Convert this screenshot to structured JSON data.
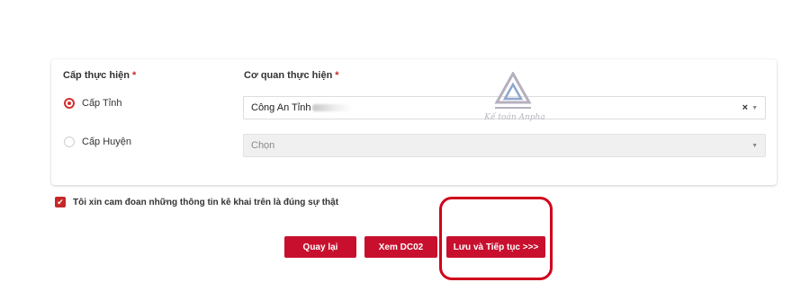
{
  "form": {
    "level_label": "Cấp thực hiện",
    "agency_label": "Cơ quan thực hiện",
    "required_mark": "*",
    "level_options": [
      {
        "label": "Cấp Tỉnh",
        "checked": true
      },
      {
        "label": "Cấp Huyện",
        "checked": false
      }
    ],
    "agency_value": "Công An Tỉnh",
    "clear_symbol": "×",
    "district_placeholder": "Chọn"
  },
  "watermark": {
    "text": "Kế toán Anpha"
  },
  "commitment": {
    "checked": true,
    "label": "Tôi xin cam đoan những thông tin kê khai trên là đúng sự thật"
  },
  "actions": {
    "back_label": "Quay lại",
    "view_label": "Xem DC02",
    "save_label": "Lưu và Tiếp tục >>>"
  },
  "colors": {
    "accent": "#c8102e",
    "highlight": "#d0021b"
  }
}
